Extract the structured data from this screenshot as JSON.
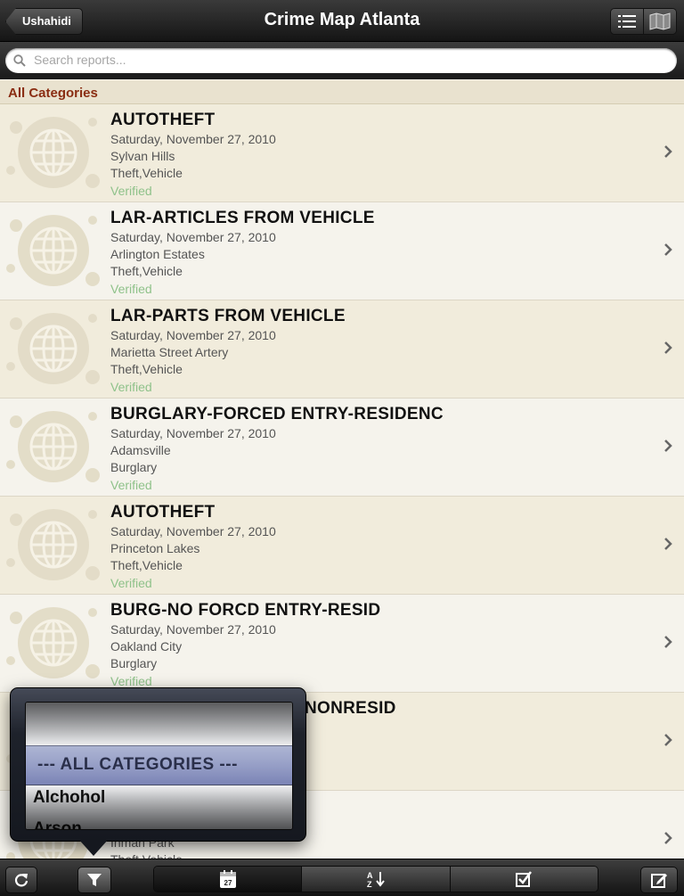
{
  "nav": {
    "back_label": "Ushahidi",
    "title": "Crime Map Atlanta"
  },
  "search": {
    "placeholder": "Search reports..."
  },
  "section_header": "All Categories",
  "reports": [
    {
      "title": "AUTOTHEFT",
      "date": "Saturday, November 27, 2010",
      "location": "Sylvan Hills",
      "category": "Theft,Vehicle",
      "status": "Verified"
    },
    {
      "title": "LAR-ARTICLES FROM VEHICLE",
      "date": "Saturday, November 27, 2010",
      "location": "Arlington Estates",
      "category": "Theft,Vehicle",
      "status": "Verified"
    },
    {
      "title": "LAR-PARTS FROM VEHICLE",
      "date": "Saturday, November 27, 2010",
      "location": "Marietta Street Artery",
      "category": "Theft,Vehicle",
      "status": "Verified"
    },
    {
      "title": "BURGLARY-FORCED ENTRY-RESIDENC",
      "date": "Saturday, November 27, 2010",
      "location": "Adamsville",
      "category": "Burglary",
      "status": "Verified"
    },
    {
      "title": "AUTOTHEFT",
      "date": "Saturday, November 27, 2010",
      "location": "Princeton Lakes",
      "category": "Theft,Vehicle",
      "status": "Verified"
    },
    {
      "title": "BURG-NO FORCD ENTRY-RESID",
      "date": "Saturday, November 27, 2010",
      "location": "Oakland City",
      "category": "Burglary",
      "status": "Verified"
    },
    {
      "title": "NONRESID",
      "date": "",
      "location": "",
      "category": "",
      "status": ""
    },
    {
      "title": "",
      "date": "",
      "location": "Inman Park",
      "category": "Theft,Vehicle",
      "status": ""
    }
  ],
  "category_picker": {
    "options": [
      "",
      "--- ALL CATEGORIES ---",
      "Alchohol",
      "Arson"
    ],
    "selected": "--- ALL CATEGORIES ---"
  },
  "toolbar": {
    "icons": [
      "refresh-icon",
      "filter-icon",
      "calendar-icon",
      "sort-icon",
      "checkbox-icon",
      "compose-icon"
    ],
    "calendar_day": "27"
  }
}
